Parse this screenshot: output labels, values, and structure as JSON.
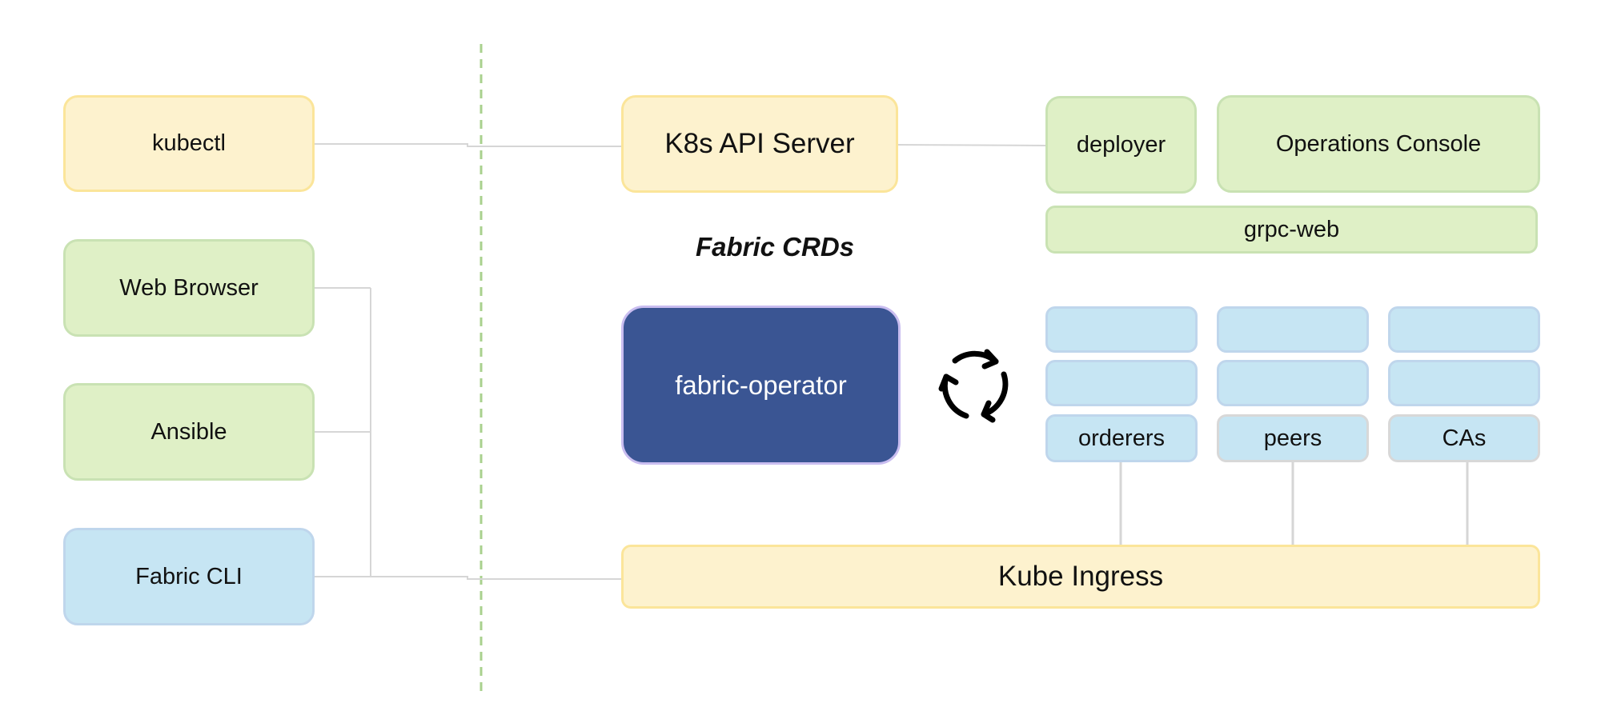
{
  "diagram": {
    "clients": [
      {
        "id": "kubectl",
        "label": "kubectl",
        "color": "yellow"
      },
      {
        "id": "web-browser",
        "label": "Web Browser",
        "color": "green"
      },
      {
        "id": "ansible",
        "label": "Ansible",
        "color": "green"
      },
      {
        "id": "fabric-cli",
        "label": "Fabric CLI",
        "color": "blue"
      }
    ],
    "cluster": {
      "k8s_api_server": "K8s API Server",
      "crd_label": "Fabric CRDs",
      "deployer": "deployer",
      "operations_console": "Operations Console",
      "grpc_web": "grpc-web",
      "fabric_operator": "fabric-operator",
      "reconcile_icon": "cycle-arrows-icon",
      "components": [
        {
          "label": "orderers"
        },
        {
          "label": "peers"
        },
        {
          "label": "CAs"
        }
      ],
      "kube_ingress": "Kube Ingress"
    },
    "connections": [
      {
        "from": "kubectl",
        "to": "K8s API Server"
      },
      {
        "from": "K8s API Server",
        "to": "deployer"
      },
      {
        "from": "Web Browser",
        "to": "Kube Ingress"
      },
      {
        "from": "Ansible",
        "to": "Kube Ingress"
      },
      {
        "from": "Fabric CLI",
        "to": "Kube Ingress"
      },
      {
        "from": "orderers",
        "to": "Kube Ingress"
      },
      {
        "from": "peers",
        "to": "Kube Ingress"
      },
      {
        "from": "CAs",
        "to": "Kube Ingress"
      }
    ],
    "boundary": "cluster-boundary-dashed-line",
    "colors": {
      "yellow_fill": "#FDF2CE",
      "green_fill": "#DFF0C6",
      "blue_fill": "#C6E5F3",
      "navy_fill": "#3A5593",
      "boundary_line": "#A9D18E",
      "connector": "#D6D6D6"
    }
  }
}
